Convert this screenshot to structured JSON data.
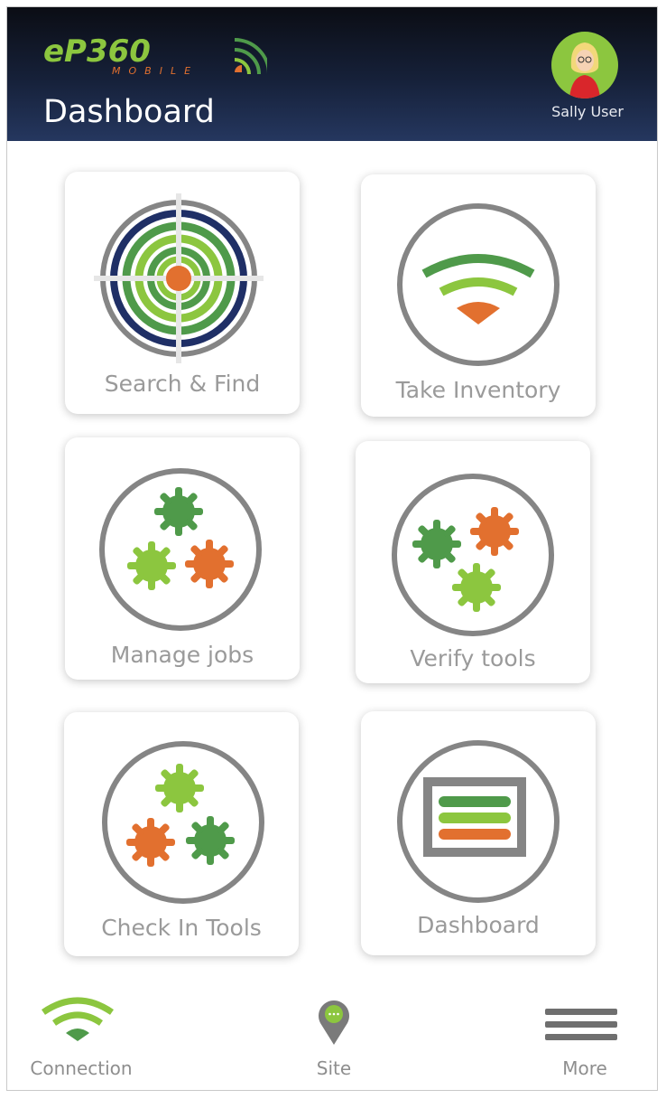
{
  "app": {
    "logo_text": "eP360",
    "logo_subtext": "MOBILE"
  },
  "header": {
    "title": "Dashboard",
    "user_name": "Sally User"
  },
  "tiles": [
    {
      "label": "Search & Find",
      "icon": "target-icon"
    },
    {
      "label": "Take Inventory",
      "icon": "signal-icon"
    },
    {
      "label": "Manage jobs",
      "icon": "gears-icon"
    },
    {
      "label": "Verify tools",
      "icon": "gears-icon"
    },
    {
      "label": "Check In Tools",
      "icon": "gears-icon"
    },
    {
      "label": "Dashboard",
      "icon": "bars-panel-icon"
    }
  ],
  "bottom_nav": [
    {
      "label": "Connection",
      "icon": "wifi-icon"
    },
    {
      "label": "Site",
      "icon": "map-pin-icon"
    },
    {
      "label": "More",
      "icon": "hamburger-menu-icon"
    }
  ],
  "colors": {
    "dark_green": "#4f9a4a",
    "light_green": "#8cc63f",
    "orange": "#e2702f",
    "navy": "#1f2f66",
    "gray_ring": "#858585"
  }
}
